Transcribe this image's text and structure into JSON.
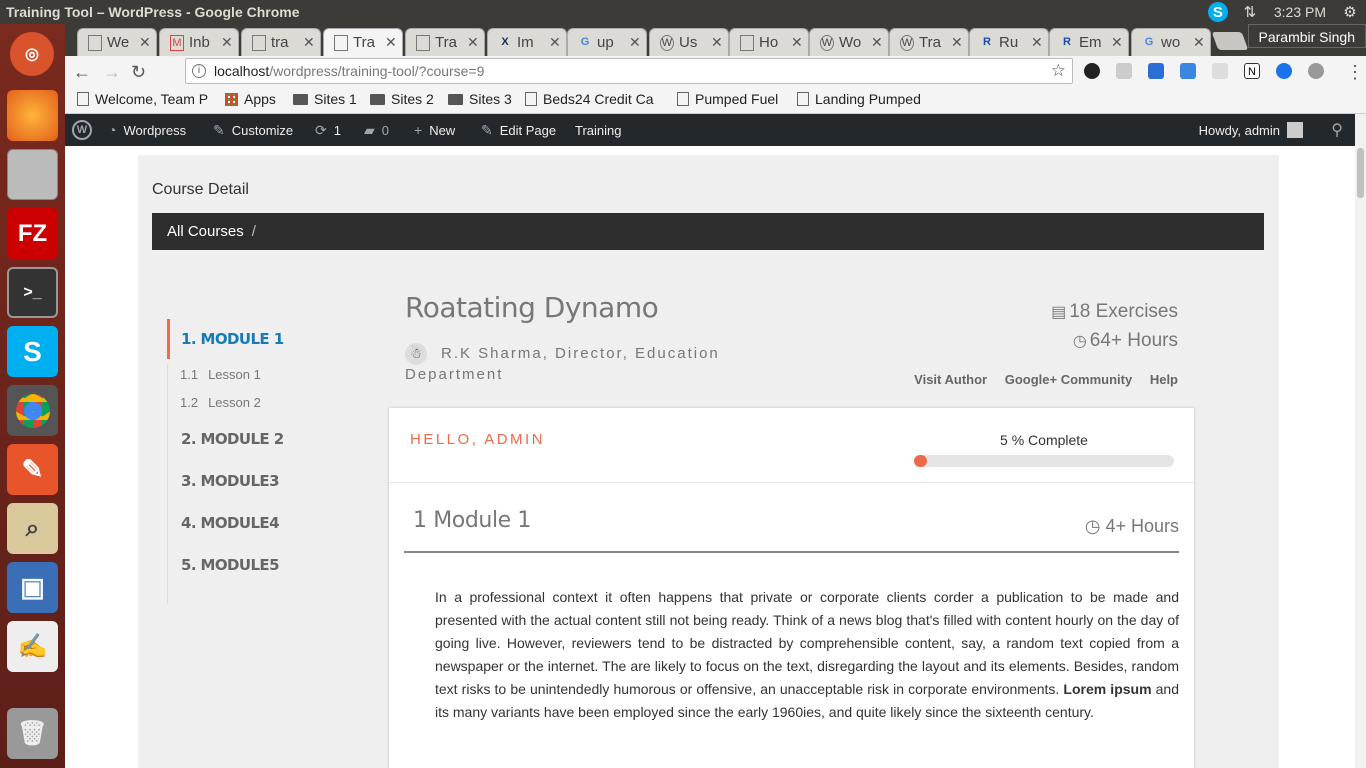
{
  "window": {
    "title": "Training Tool – WordPress - Google Chrome"
  },
  "tray": {
    "time": "3:23 PM",
    "user": "Parambir Singh"
  },
  "tabs": [
    {
      "label": "We",
      "icon": "page-icon"
    },
    {
      "label": "Inb",
      "icon": "gmail-icon"
    },
    {
      "label": "tra",
      "icon": "page-icon"
    },
    {
      "label": "Tra",
      "icon": "page-icon"
    },
    {
      "label": "Tra",
      "icon": "page-icon"
    },
    {
      "label": "Im",
      "icon": "x-icon"
    },
    {
      "label": "up",
      "icon": "google-icon"
    },
    {
      "label": "Us",
      "icon": "wordpress-icon"
    },
    {
      "label": "Ho",
      "icon": "page-icon"
    },
    {
      "label": "Wo",
      "icon": "wordpress-icon"
    },
    {
      "label": "Tra",
      "icon": "wordpress-icon"
    },
    {
      "label": "Ru",
      "icon": "r-icon"
    },
    {
      "label": "Em",
      "icon": "r-icon"
    },
    {
      "label": "wo",
      "icon": "google-icon"
    }
  ],
  "omnibox": {
    "host": "localhost",
    "path": "/wordpress/training-tool/?course=9"
  },
  "bookmarks": [
    {
      "label": "Welcome, Team P",
      "kind": "page"
    },
    {
      "label": "Apps",
      "kind": "apps"
    },
    {
      "label": "Sites 1",
      "kind": "folder"
    },
    {
      "label": "Sites 2",
      "kind": "folder"
    },
    {
      "label": "Sites 3",
      "kind": "folder"
    },
    {
      "label": "Beds24 Credit Ca",
      "kind": "page"
    },
    {
      "label": "Pumped Fuel",
      "kind": "page"
    },
    {
      "label": "Landing Pumped",
      "kind": "page"
    }
  ],
  "adminbar": {
    "site": "Wordpress",
    "customize": "Customize",
    "updates": "1",
    "comments": "0",
    "new": "New",
    "edit": "Edit Page",
    "training": "Training",
    "howdy": "Howdy, admin"
  },
  "page": {
    "heading": "Course Detail",
    "breadcrumb": "All Courses",
    "breadcrumb_sep": "/",
    "course_title": "Roatating Dynamo",
    "author": "R.K Sharma, Director, Education Department",
    "exercises": "18 Exercises",
    "hours": "64+ Hours",
    "links": [
      "Visit Author",
      "Google+ Community",
      "Help"
    ],
    "greeting": "HELLO, ADMIN",
    "progress_label": "5 % Complete",
    "progress_fraction": 0.05,
    "module_title": "1 Module 1",
    "module_hours": "4+ Hours",
    "body_pre": "In a professional context it often happens that private or corporate clients corder a publication to be made and presented with the actual content still not being ready. Think of a news blog that's filled with content hourly on the day of going live. However, reviewers tend to be distracted by comprehensible content, say, a random text copied from a newspaper or the internet. The are likely to focus on the text, disregarding the layout and its elements. Besides, random text risks to be unintendedly humorous or offensive, an unacceptable risk in corporate environments. ",
    "body_bold": "Lorem ipsum",
    "body_post": " and its many variants have been employed since the early 1960ies, and quite likely since the sixteenth century."
  },
  "sidebar": {
    "modules": [
      {
        "label": "1. MODULE 1"
      },
      {
        "label": "2. MODULE 2"
      },
      {
        "label": "3. MODULE3"
      },
      {
        "label": "4. MODULE4"
      },
      {
        "label": "5. MODULE5"
      }
    ],
    "lessons": [
      {
        "num": "1.1",
        "label": "Lesson 1"
      },
      {
        "num": "1.2",
        "label": "Lesson 2"
      }
    ]
  },
  "colors": {
    "accent": "#ee6a4a",
    "link_active": "#1a7ab8",
    "adminbar": "#23282d"
  }
}
